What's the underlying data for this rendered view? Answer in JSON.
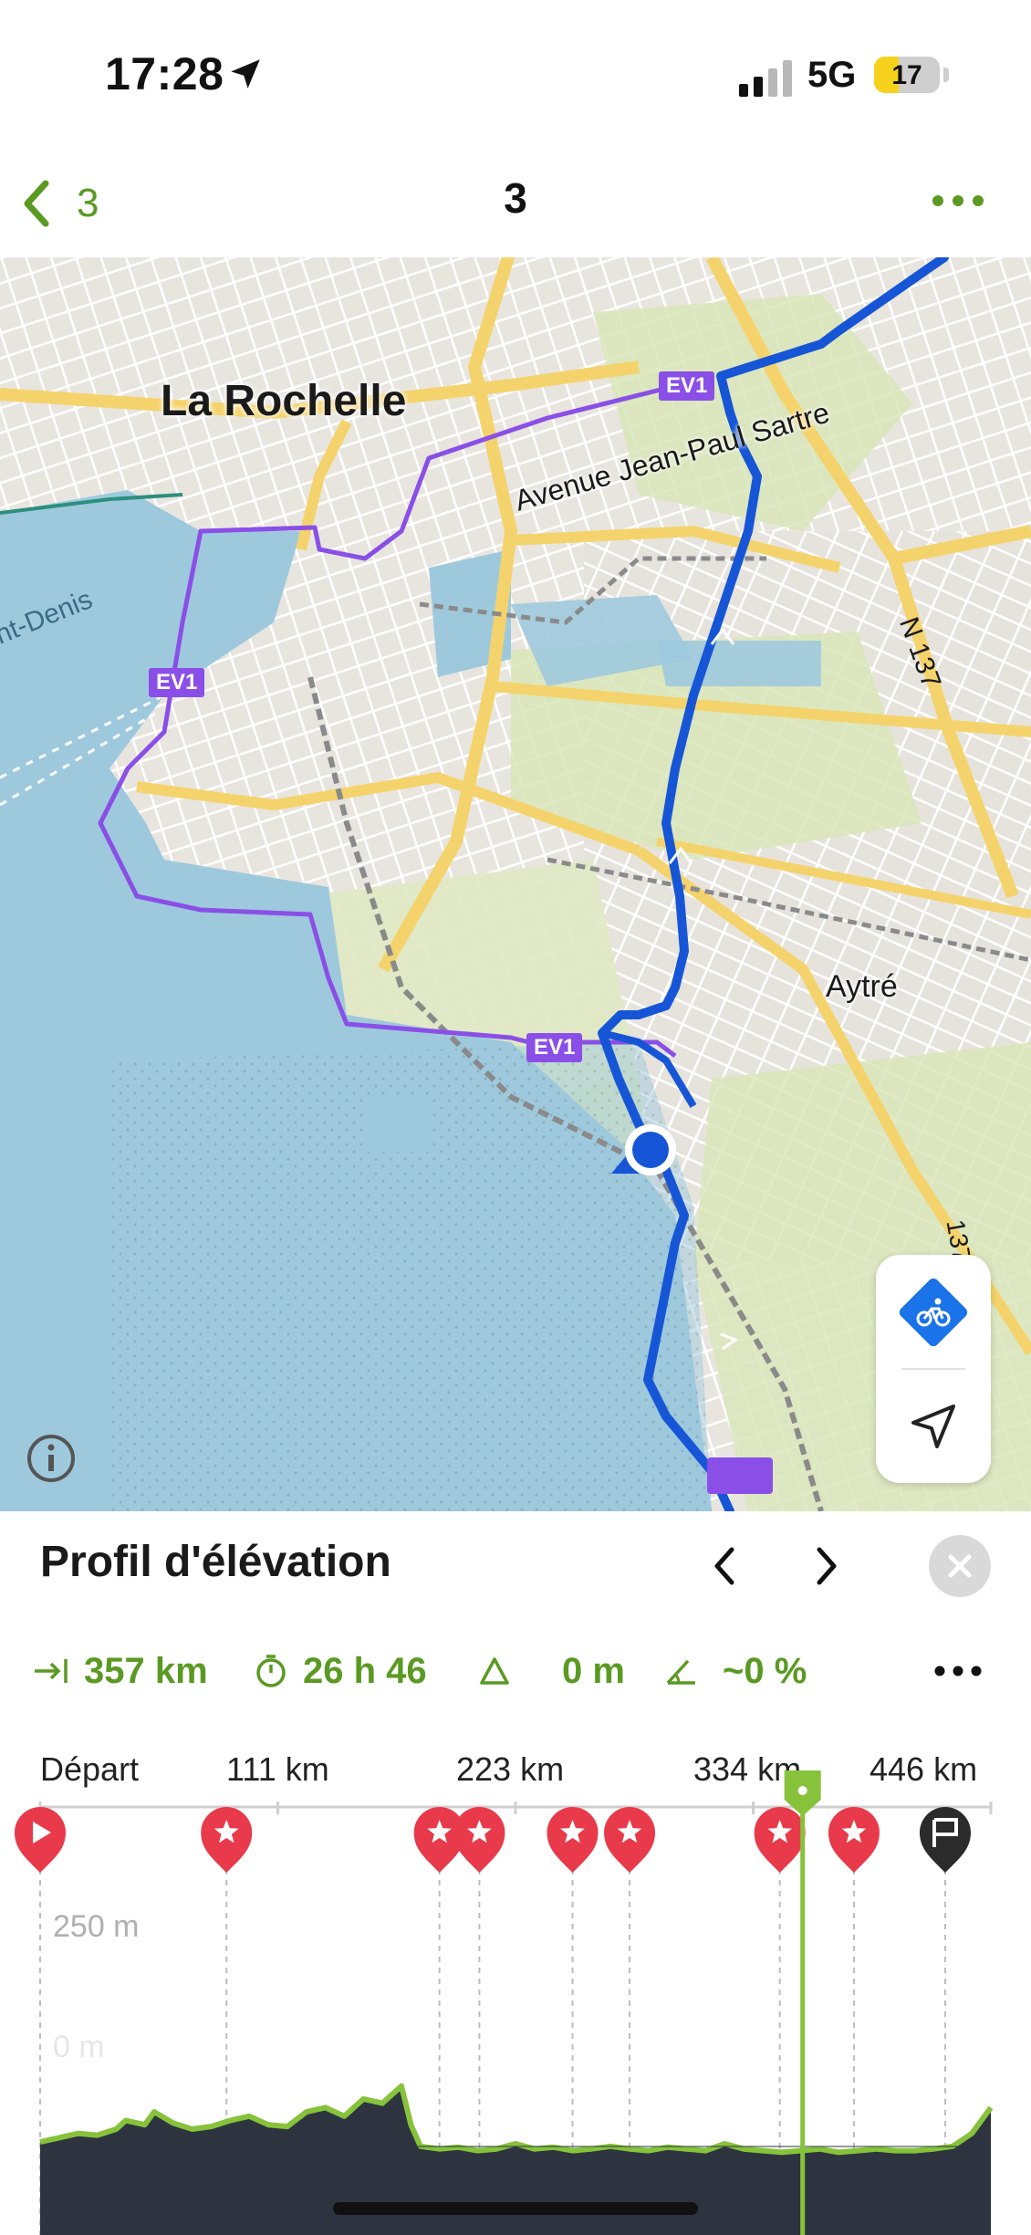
{
  "status_bar": {
    "time": "17:28",
    "network": "5G",
    "battery": "17",
    "battery_level": 0.17,
    "icons": [
      "location-arrow-icon",
      "signal-icon",
      "battery-icon"
    ]
  },
  "nav": {
    "back_label": "3",
    "title": "3",
    "back_icon": "chevron-left-icon",
    "more_icon": "more-dots-icon"
  },
  "map": {
    "labels": {
      "city": "La Rochelle",
      "avenue": "Avenue Jean-Paul Sartre",
      "town": "Aytré",
      "road": "N 137",
      "road2": "137",
      "water": "nt-Denis",
      "ev1": "EV1"
    },
    "colors": {
      "route": "#1656d6",
      "ev1": "#8a4fe6",
      "water": "#9ec9dd",
      "land": "#eceae5",
      "green": "#d8e6b8",
      "major_road": "#f5d36c"
    },
    "controls": [
      "bike-mode-icon",
      "locate-arrow-icon"
    ],
    "info_icon": "info-icon"
  },
  "sheet": {
    "title": "Profil d'élévation",
    "stats": {
      "distance": "357 km",
      "duration": "26 h 46",
      "ascent": "0 m",
      "grade": "~0 %"
    },
    "km_labels": [
      "Départ",
      "111 km",
      "223 km",
      "334 km",
      "446 km"
    ],
    "elevation_labels": {
      "top": "250 m",
      "bottom": "0 m"
    },
    "colors": {
      "accent": "#5a9a22",
      "poi": "#e83a4a",
      "profile_fill": "#2d3440",
      "profile_line": "#86c23a"
    }
  },
  "chart_data": {
    "type": "area",
    "title": "Profil d'élévation",
    "xlabel": "",
    "ylabel": "",
    "x_tick_labels": [
      "Départ",
      "111 km",
      "223 km",
      "334 km",
      "446 km"
    ],
    "y_tick_labels": [
      "250 m",
      "0 m"
    ],
    "x_unit": "km",
    "xlim": [
      0,
      500
    ],
    "ylim": [
      0,
      250
    ],
    "x": [
      0,
      10,
      20,
      30,
      40,
      45,
      55,
      60,
      70,
      80,
      90,
      100,
      110,
      120,
      130,
      140,
      150,
      160,
      170,
      180,
      190,
      195,
      200,
      210,
      220,
      230,
      240,
      250,
      260,
      270,
      280,
      290,
      300,
      310,
      320,
      330,
      340,
      350,
      360,
      370,
      380,
      390,
      400,
      410,
      420,
      430,
      440,
      450,
      460,
      470,
      480,
      490,
      500
    ],
    "y": [
      20,
      25,
      30,
      28,
      35,
      45,
      40,
      55,
      42,
      35,
      38,
      45,
      50,
      40,
      38,
      55,
      60,
      50,
      70,
      65,
      85,
      40,
      15,
      12,
      14,
      10,
      12,
      18,
      12,
      14,
      10,
      12,
      15,
      12,
      10,
      14,
      12,
      10,
      18,
      12,
      10,
      8,
      10,
      12,
      8,
      10,
      12,
      10,
      10,
      12,
      15,
      30,
      60
    ],
    "current_position_km": 401,
    "poi_markers_km": [
      0,
      98,
      210,
      231,
      280,
      310,
      389,
      428,
      476
    ],
    "poi_types": [
      "start",
      "star",
      "star",
      "star",
      "star",
      "star",
      "star",
      "star",
      "finish"
    ]
  }
}
